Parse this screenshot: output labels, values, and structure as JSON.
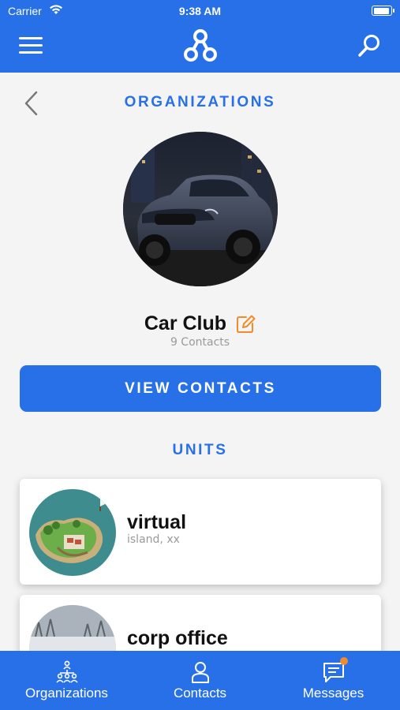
{
  "status_bar": {
    "carrier": "Carrier",
    "time": "9:38 AM",
    "battery_level": 0.92
  },
  "header": {
    "menu_icon": "hamburger-menu-icon",
    "logo_icon": "three-node-network-logo",
    "search_icon": "search-icon"
  },
  "page": {
    "title": "ORGANIZATIONS",
    "back_icon": "chevron-left-icon"
  },
  "organization": {
    "name": "Car Club",
    "contacts_count": "9 Contacts",
    "edit_icon": "pencil-edit-icon",
    "avatar": "dark luxury SUV photo"
  },
  "actions": {
    "view_contacts_label": "VIEW CONTACTS"
  },
  "units": {
    "section_title": "UNITS",
    "items": [
      {
        "name": "virtual",
        "location": "island, xx",
        "thumb": "island illustration"
      },
      {
        "name": "corp office",
        "location": "",
        "thumb": "snowy landscape photo"
      }
    ]
  },
  "tab_bar": {
    "tabs": [
      {
        "label": "Organizations",
        "icon": "organization-tree-icon"
      },
      {
        "label": "Contacts",
        "icon": "person-icon"
      },
      {
        "label": "Messages",
        "icon": "message-bubble-icon",
        "has_badge": true
      }
    ]
  },
  "colors": {
    "primary": "#2870e8",
    "badge": "#f28c2b",
    "edit_icon": "#f28c2b",
    "background": "#f4f4f4"
  }
}
